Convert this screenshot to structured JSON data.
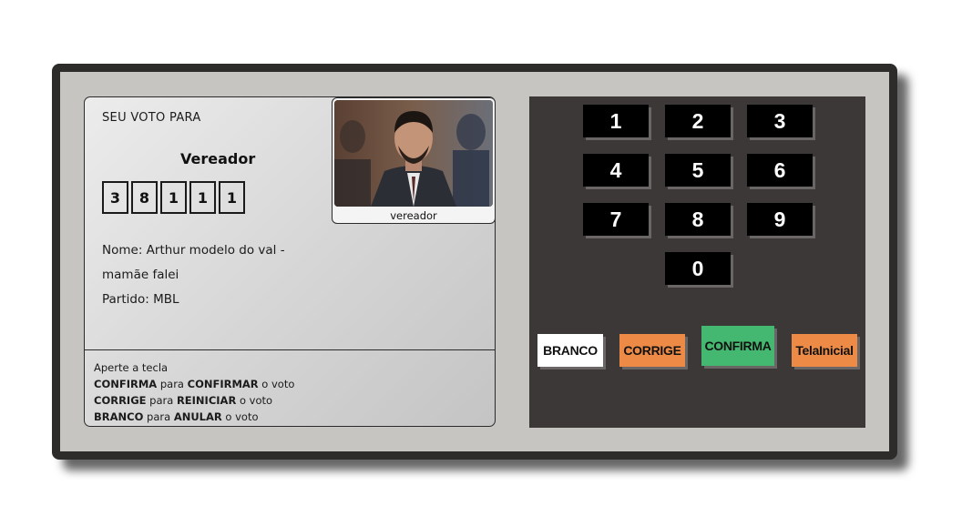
{
  "screen": {
    "heading": "SEU VOTO PARA",
    "office": "Vereador",
    "digits": [
      "3",
      "8",
      "1",
      "1",
      "1"
    ],
    "candidate": {
      "name_line1": "Nome: Arthur modelo do val -",
      "name_line2": "mamãe falei",
      "party": "Partido: MBL",
      "photo_caption": "vereador"
    },
    "instructions": {
      "intro": "Aperte a tecla",
      "line1": [
        "CONFIRMA",
        " para ",
        "CONFIRMAR",
        " o voto"
      ],
      "line2": [
        "CORRIGE",
        " para ",
        "REINICIAR",
        " o voto"
      ],
      "line3": [
        "BRANCO",
        " para ",
        "ANULAR",
        " o voto"
      ]
    }
  },
  "keypad": {
    "keys": [
      "1",
      "2",
      "3",
      "4",
      "5",
      "6",
      "7",
      "8",
      "9",
      "0"
    ],
    "actions": {
      "branco": "BRANCO",
      "corrige": "CORRIGE",
      "confirma": "CONFIRMA",
      "tela_inicial": "TelaInicial"
    }
  },
  "colors": {
    "frame": "#2e2b2b",
    "body": "#c6c5c1",
    "keypad": "#3d3838",
    "branco": "#ffffff",
    "corrige": "#ec8a46",
    "confirma": "#44b870",
    "tela_inicial": "#ec8a46"
  }
}
